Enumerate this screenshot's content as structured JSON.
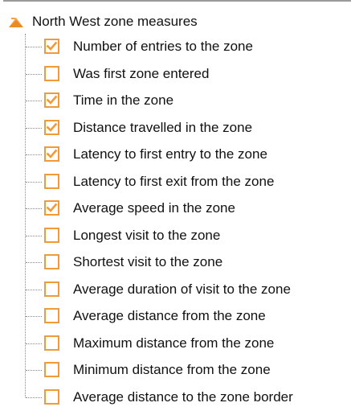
{
  "tree": {
    "root_label": "North West zone measures",
    "root_icon": "folder-icon",
    "accent_color": "#f19a38",
    "items": [
      {
        "label": "Number of entries to the zone",
        "checked": true
      },
      {
        "label": "Was first zone entered",
        "checked": false
      },
      {
        "label": "Time in the zone",
        "checked": true
      },
      {
        "label": "Distance travelled in the zone",
        "checked": true
      },
      {
        "label": "Latency to first entry to the zone",
        "checked": true
      },
      {
        "label": "Latency to first exit from the zone",
        "checked": false
      },
      {
        "label": "Average speed in the zone",
        "checked": true
      },
      {
        "label": "Longest visit to the zone",
        "checked": false
      },
      {
        "label": "Shortest visit to the zone",
        "checked": false
      },
      {
        "label": "Average duration of visit to the zone",
        "checked": false
      },
      {
        "label": "Average distance from the zone",
        "checked": false
      },
      {
        "label": "Maximum distance from the zone",
        "checked": false
      },
      {
        "label": "Minimum distance from the zone",
        "checked": false
      },
      {
        "label": "Average distance to the zone border",
        "checked": false
      }
    ]
  }
}
